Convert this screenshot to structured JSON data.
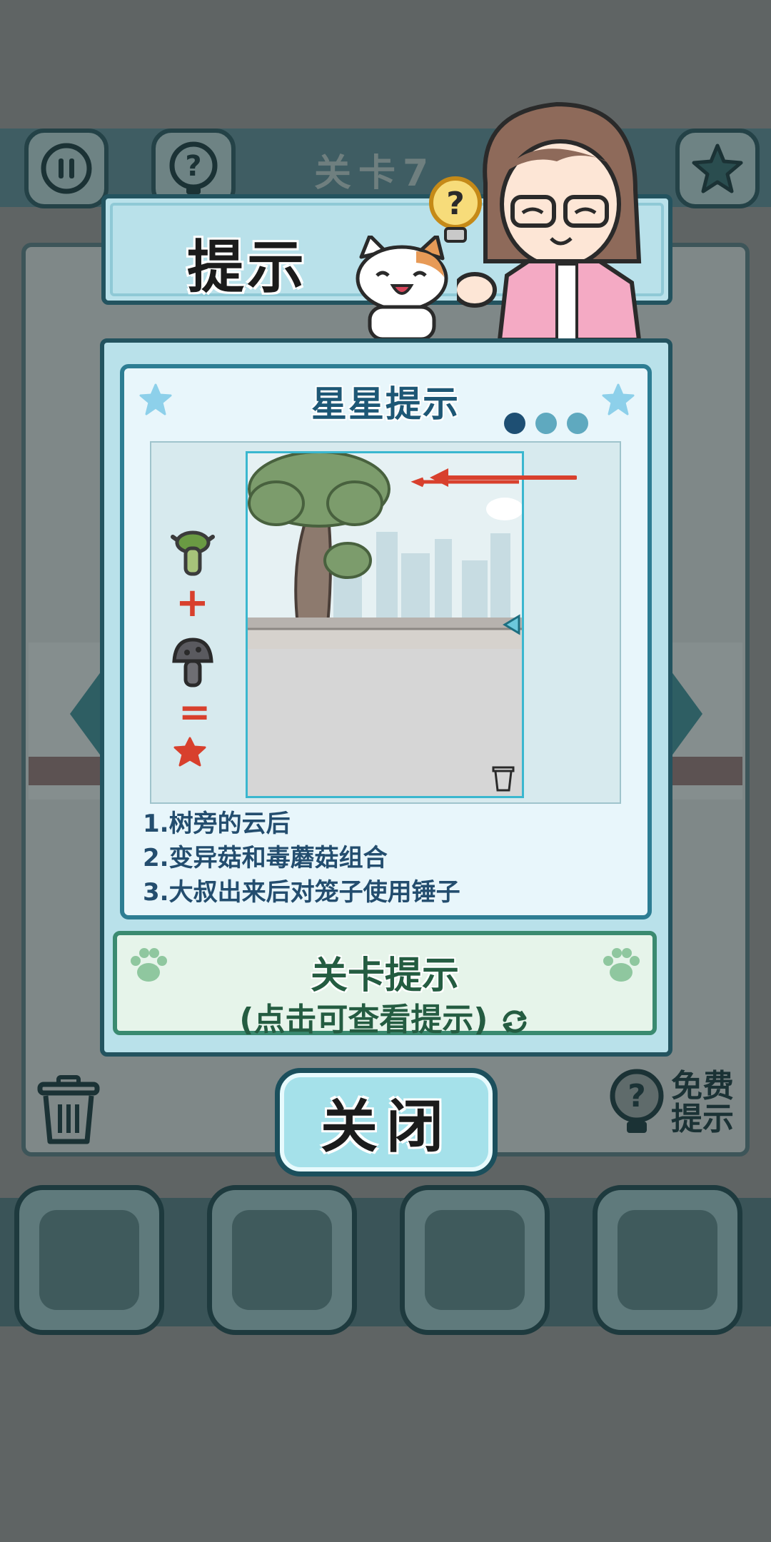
{
  "background": {
    "level_title": "关卡7",
    "free_hint_label": "免费提示"
  },
  "dialog": {
    "title": "提示",
    "card_title": "星星提示",
    "page_count": 3,
    "active_page": 1,
    "tips": [
      "1.树旁的云后",
      "2.变异菇和毒蘑菇组合",
      "3.大叔出来后对笼子使用锤子"
    ],
    "formula": {
      "plus": "+",
      "equals": "="
    },
    "level_hint_title": "关卡提示",
    "level_hint_subtitle": "(点击可查看提示)",
    "close_label": "关闭"
  },
  "colors": {
    "panel": "#b9e1ea",
    "border": "#23535f",
    "tip_text": "#234d6e",
    "accent_red": "#d8402d",
    "level_hint_green": "#245c41"
  },
  "icons": [
    "pause-icon",
    "question-icon",
    "star-icon",
    "trash-icon",
    "lightbulb-question-icon",
    "paw-icon",
    "refresh-icon",
    "arrow-icon"
  ]
}
